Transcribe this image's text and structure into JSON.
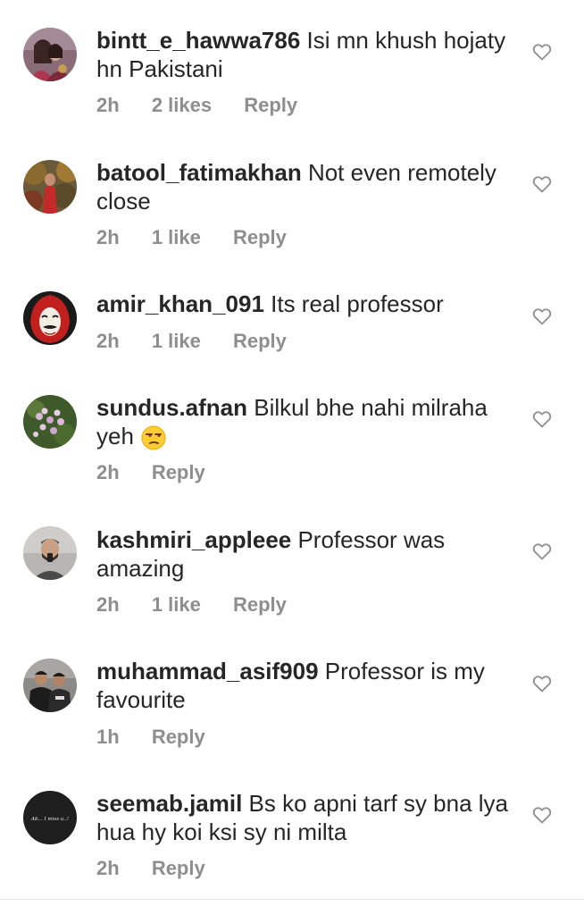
{
  "comments": [
    {
      "username": "bintt_e_hawwa786",
      "text": " Isi mn khush hojaty hn Pakistani",
      "time": "2h",
      "likes": "2 likes",
      "reply": "Reply",
      "avatar": "avatar-couple-photo"
    },
    {
      "username": "batool_fatimakhan",
      "text": " Not even remotely close",
      "time": "2h",
      "likes": "1 like",
      "reply": "Reply",
      "avatar": "avatar-person-outdoors"
    },
    {
      "username": "amir_khan_091",
      "text": " Its real professor",
      "time": "2h",
      "likes": "1 like",
      "reply": "Reply",
      "avatar": "avatar-dali-mask"
    },
    {
      "username": "sundus.afnan",
      "text": " Bilkul bhe nahi milraha yeh ",
      "time": "2h",
      "likes": "",
      "reply": "Reply",
      "avatar": "avatar-flowers",
      "emoji": "unamused-face-emoji"
    },
    {
      "username": "kashmiri_appleee",
      "text": " Professor was amazing",
      "time": "2h",
      "likes": "1 like",
      "reply": "Reply",
      "avatar": "avatar-man-selfie"
    },
    {
      "username": "muhammad_asif909",
      "text": " Professor is my favourite",
      "time": "1h",
      "likes": "",
      "reply": "Reply",
      "avatar": "avatar-two-men"
    },
    {
      "username": "seemab.jamil",
      "text": " Bs ko apni tarf sy bna lya hua hy koi ksi sy ni milta",
      "time": "2h",
      "likes": "",
      "reply": "Reply",
      "avatar": "avatar-dark-text-logo",
      "avatar_text": "Ab... I miss u..!"
    }
  ],
  "icons": {
    "like": "heart-outline-icon"
  },
  "colors": {
    "text": "#262626",
    "meta": "#8e8e8e",
    "heart_stroke": "#8e8e8e",
    "background": "#ffffff"
  }
}
